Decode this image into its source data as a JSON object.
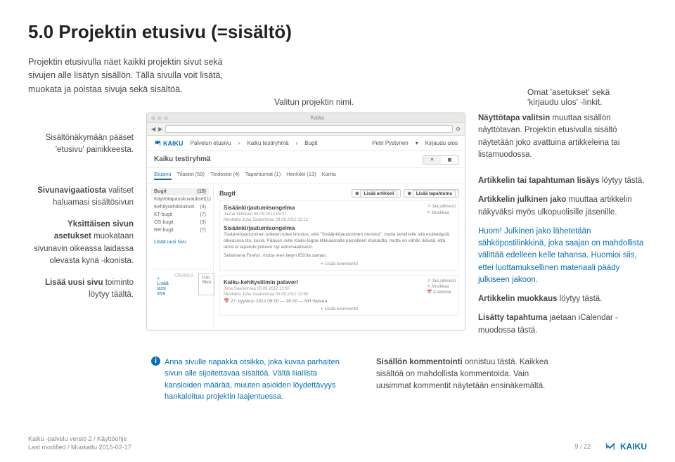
{
  "title": "5.0 Projektin etusivu (=sisältö)",
  "intro": "Projektin etusivulla näet kaikki projektin sivut sekä sivujen alle lisätyn sisällön. Tällä sivulla voit lisätä, muokata ja poistaa sivuja sekä sisältöä.",
  "topAnn": {
    "a": "Valitun projektin nimi.",
    "b": "Omat 'asetukset' sekä 'kirjaudu ulos' -linkit."
  },
  "leftAnn": {
    "p1": "Sisältönäkymään pääset 'etusivu' painikkeesta.",
    "p2_strong": "Sivunavigaatiosta",
    "p2_rest": " valitset haluamasi sisältösivun",
    "p3_strong1": "Yksittäisen sivun asetukset",
    "p3_rest": " muokataan sivunavin oikeassa laidassa olevasta kynä -ikonista.",
    "p4_strong": "Lisää uusi sivu",
    "p4_rest": " toiminto löytyy täältä."
  },
  "rightAnn": {
    "p1_strong": "Näyttötapa valitsin",
    "p1_rest": " muuttaa sisällön näyttötavan. Projektin etusivulla sisältö näytetään joko avattuina artikkeleina tai listamuodossa.",
    "p2_strong": "Artikkelin tai tapahtuman lisäys",
    "p2_rest": " löytyy tästä.",
    "p3_strong": "Artikkelin julkinen jako",
    "p3_rest": " muuttaa artikkelin näkyväksi myös ulkopuolisille jäsenille.",
    "p4": "Huom! Julkinen jako lähetetään sähköpostilinkkinä, joka saajan on mahdollista välittää edelleen kelle tahansa. Huomioi siis, ettei luottamuksellinen materiaali päädy julkiseen jakoon.",
    "p5_strong": "Artikkelin muokkaus",
    "p5_rest": " löytyy tästä.",
    "p6_strong": "Lisätty tapahtuma",
    "p6_rest": " jaetaan iCalendar -muodossa tästä."
  },
  "tip": "Anna sivulle napakka otsikko, joka kuvaa parhaiten sivun alle sijoitettavaa sisältöä. Vältä liiallista kansioiden määrää, muuten asioiden löydettävyys hankaloituu projektin laajentuessa.",
  "botRight_strong": "Sisällön kommentointi",
  "botRight_rest": " onnistuu tästä. Kaikkea sisältöä on mahdollista kommentoida. Vain uusimmat kommentit näytetään ensinäkemältä.",
  "footer": {
    "l1": "Kaiku -palvelu versio 2 / Käyttöohje",
    "l2": "Last modified / Muokattu 2015-02-17",
    "page": "9 / 22",
    "brand": "KAIKU"
  },
  "shot": {
    "winTitle": "Kaiku",
    "brand": "KAIKU",
    "nav1": "Palvelun etusivu",
    "nav2": "Kaiku testiryhmä",
    "nav3": "Bugit",
    "user": "Petri Pystynen",
    "logout": "Kirjaudu ulos",
    "projTitle": "Kaiku testiryhmä",
    "tabs": [
      "Etusivu",
      "Tilastot (59)",
      "Tiedostot (4)",
      "Tapahtumat (1)",
      "Henkilöt (13)",
      "Kartta"
    ],
    "toggle": [
      "≡",
      "▦"
    ],
    "side": [
      {
        "label": "Bugit",
        "count": "(15)"
      },
      {
        "label": "Käyttötapauskuvaukset",
        "count": "(1)"
      },
      {
        "label": "Kehitysehdotukset",
        "count": "(4)"
      },
      {
        "label": "KT-bugit",
        "count": "(7)"
      },
      {
        "label": "OS-bugit",
        "count": "(3)"
      },
      {
        "label": "RR-bugit",
        "count": "(7)"
      }
    ],
    "addLink": "Lisää uusi sivu",
    "addNew": "+ Lisää uusi sivu",
    "etiLabel": "Otsikko",
    "etiBtn": "Luo Sivu",
    "pageTitle": "Bugit",
    "btn1": "Lisää artikkeli",
    "btn2": "Lisää tapahtuma",
    "card1": {
      "title": "Sisäänkirjautumisongelma",
      "meta1": "Jaana Vilhonen 05.09.2012 08:07",
      "meta2": "Muokattu Juha Saarenmaa 29.08.2012 11:12",
      "title2": "Sisäänkirjautumisongelma",
      "body": "Sisäänkirjautuminen jotkeen tulee ilmoitus, että \"Sisäänkirjautuminen onnistui\", mutta tavallisille sitä etullekäydä oikeasssa tila, kuvia. Pääsen sulle Kaiku-logoa klikkaamalla painalleen etukautta, mutta on vähän ikävää, että tämä ei tapahdu jotkeen nyt automaattisesti.",
      "body2": "Selaimena Firefox, mutta teen tietyn IE8:lla saman.",
      "r1": "Jaa julkisesti",
      "r2": "Muokkaa",
      "addc": "+ Lisää kommentti"
    },
    "card2": {
      "title": "Kaiku-kehitystiimin palaveri",
      "meta1": "Juha Saarenmaa 05.09.2012 13:50",
      "meta2": "Muokattu Juha Saarenmaa 05.09.2012 13:50",
      "date": "27. syyskuu 2012 09:00 — 16:00 — NH Vaisala",
      "r1": "Jaa julkisesti",
      "r2": "Muokkaa",
      "r3": "iCalendar",
      "addc": "+ Lisää kommentti"
    }
  }
}
